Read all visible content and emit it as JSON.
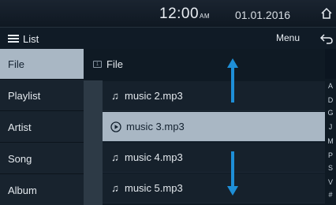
{
  "status": {
    "time": "12:00",
    "ampm": "AM",
    "date": "01.01.2016"
  },
  "header": {
    "list_label": "List",
    "menu_label": "Menu"
  },
  "categories": [
    {
      "label": "File",
      "active": true
    },
    {
      "label": "Playlist",
      "active": false
    },
    {
      "label": "Artist",
      "active": false
    },
    {
      "label": "Song",
      "active": false
    },
    {
      "label": "Album",
      "active": false
    }
  ],
  "list": {
    "header_label": "File",
    "folder_badge": "1",
    "rows": [
      {
        "title": "music 2.mp3",
        "playing": false
      },
      {
        "title": "music 3.mp3",
        "playing": true
      },
      {
        "title": "music 4.mp3",
        "playing": false
      },
      {
        "title": "music 5.mp3",
        "playing": false
      }
    ]
  },
  "alpha_index": [
    "A",
    "D",
    "G",
    "J",
    "M",
    "P",
    "S",
    "V",
    "#"
  ],
  "colors": {
    "accent_arrow": "#1e8fd8",
    "highlight": "#a9b7c4"
  }
}
